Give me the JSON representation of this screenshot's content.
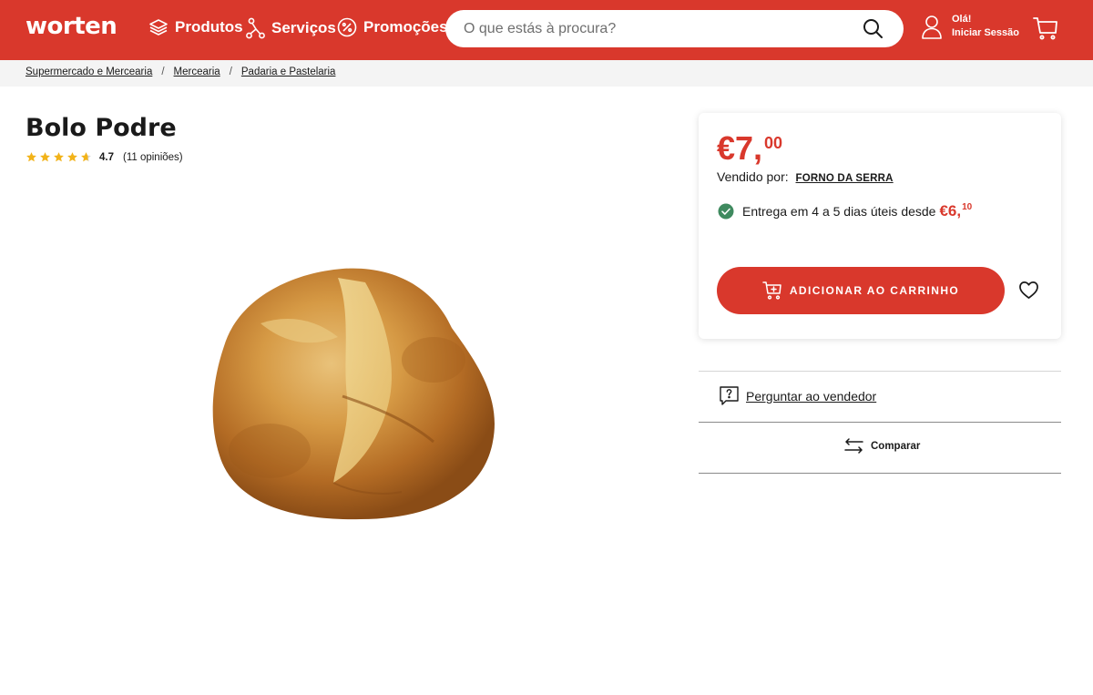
{
  "header": {
    "logo": "worten",
    "nav": [
      {
        "label": "Produtos",
        "icon": "layers-icon"
      },
      {
        "label": "Serviços",
        "icon": "network-icon"
      },
      {
        "label": "Promoções",
        "icon": "percent-icon"
      }
    ],
    "search": {
      "placeholder": "O que estás à procura?",
      "value": ""
    },
    "user": {
      "greeting": "Olá!",
      "login_label": "Iniciar Sessão"
    },
    "colors": {
      "brand": "#d9382c"
    }
  },
  "breadcrumb": [
    "Supermercado e Mercearia",
    "Mercearia",
    "Padaria e Pastelaria"
  ],
  "product": {
    "title": "Bolo Podre",
    "rating": {
      "value": "4.7",
      "stars": 4.7,
      "reviews": "(11 opiniões)"
    }
  },
  "offer": {
    "price_main": "€7,",
    "price_cents": "00",
    "seller_label": "Vendido por:",
    "seller_name": "FORNO DA SERRA",
    "delivery_text": "Entrega em 4 a 5 dias úteis desde",
    "delivery_price_main": "€6,",
    "delivery_price_cents": "10",
    "add_to_cart": "ADICIONAR AO CARRINHO"
  },
  "actions": {
    "ask_seller": "Perguntar ao vendedor",
    "compare": "Comparar"
  }
}
